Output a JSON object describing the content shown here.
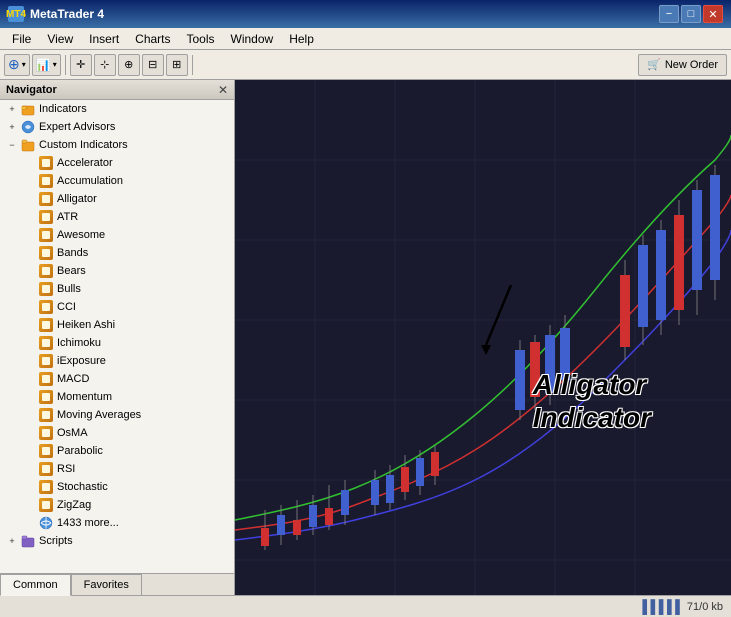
{
  "titleBar": {
    "title": "MetaTrader 4",
    "icon": "MT4",
    "controls": [
      "minimize",
      "maximize",
      "close"
    ]
  },
  "menuBar": {
    "items": [
      "File",
      "View",
      "Insert",
      "Charts",
      "Tools",
      "Window",
      "Help"
    ]
  },
  "toolbar": {
    "newOrderLabel": "New Order"
  },
  "navigator": {
    "title": "Navigator",
    "sections": [
      {
        "id": "indicators",
        "label": "Indicators",
        "type": "folder",
        "level": 0,
        "expanded": false
      },
      {
        "id": "expert-advisors",
        "label": "Expert Advisors",
        "type": "folder",
        "level": 0,
        "expanded": false
      },
      {
        "id": "custom-indicators",
        "label": "Custom Indicators",
        "type": "folder",
        "level": 0,
        "expanded": true
      },
      {
        "id": "accelerator",
        "label": "Accelerator",
        "type": "indicator",
        "level": 1
      },
      {
        "id": "accumulation",
        "label": "Accumulation",
        "type": "indicator",
        "level": 1
      },
      {
        "id": "alligator",
        "label": "Alligator",
        "type": "indicator",
        "level": 1
      },
      {
        "id": "atr",
        "label": "ATR",
        "type": "indicator",
        "level": 1
      },
      {
        "id": "awesome",
        "label": "Awesome",
        "type": "indicator",
        "level": 1
      },
      {
        "id": "bands",
        "label": "Bands",
        "type": "indicator",
        "level": 1
      },
      {
        "id": "bears",
        "label": "Bears",
        "type": "indicator",
        "level": 1
      },
      {
        "id": "bulls",
        "label": "Bulls",
        "type": "indicator",
        "level": 1
      },
      {
        "id": "cci",
        "label": "CCI",
        "type": "indicator",
        "level": 1
      },
      {
        "id": "heiken-ashi",
        "label": "Heiken Ashi",
        "type": "indicator",
        "level": 1
      },
      {
        "id": "ichimoku",
        "label": "Ichimoku",
        "type": "indicator",
        "level": 1
      },
      {
        "id": "iexposure",
        "label": "iExposure",
        "type": "indicator",
        "level": 1
      },
      {
        "id": "macd",
        "label": "MACD",
        "type": "indicator",
        "level": 1
      },
      {
        "id": "momentum",
        "label": "Momentum",
        "type": "indicator",
        "level": 1
      },
      {
        "id": "moving-averages",
        "label": "Moving Averages",
        "type": "indicator",
        "level": 1
      },
      {
        "id": "osma",
        "label": "OsMA",
        "type": "indicator",
        "level": 1
      },
      {
        "id": "parabolic",
        "label": "Parabolic",
        "type": "indicator",
        "level": 1
      },
      {
        "id": "rsi",
        "label": "RSI",
        "type": "indicator",
        "level": 1
      },
      {
        "id": "stochastic",
        "label": "Stochastic",
        "type": "indicator",
        "level": 1
      },
      {
        "id": "zigzag",
        "label": "ZigZag",
        "type": "indicator",
        "level": 1
      },
      {
        "id": "more",
        "label": "1433 more...",
        "type": "world",
        "level": 1
      },
      {
        "id": "scripts",
        "label": "Scripts",
        "type": "folder",
        "level": 0,
        "expanded": false
      }
    ],
    "tabs": [
      {
        "id": "common",
        "label": "Common",
        "active": true
      },
      {
        "id": "favorites",
        "label": "Favorites",
        "active": false
      }
    ]
  },
  "chart": {
    "annotation": {
      "line1": "Alligator",
      "line2": "Indicator"
    }
  },
  "statusBar": {
    "chartIcon": "▐▐▐▐▐",
    "info": "71/0 kb"
  }
}
